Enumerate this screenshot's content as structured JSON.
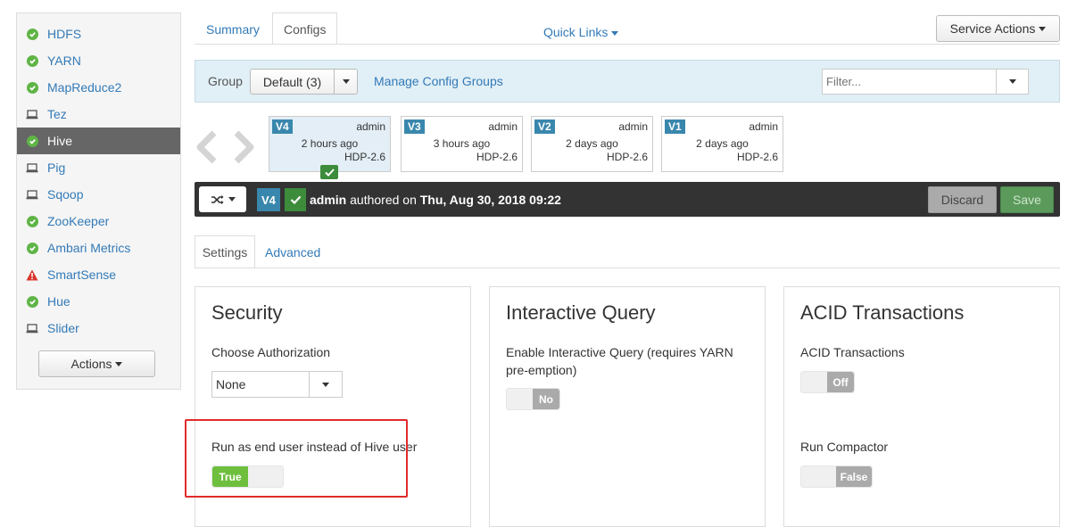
{
  "sidebar": {
    "items": [
      {
        "label": "HDFS",
        "status": "ok"
      },
      {
        "label": "YARN",
        "status": "ok"
      },
      {
        "label": "MapReduce2",
        "status": "ok"
      },
      {
        "label": "Tez",
        "status": "client"
      },
      {
        "label": "Hive",
        "status": "ok"
      },
      {
        "label": "Pig",
        "status": "client"
      },
      {
        "label": "Sqoop",
        "status": "client"
      },
      {
        "label": "ZooKeeper",
        "status": "ok"
      },
      {
        "label": "Ambari Metrics",
        "status": "ok"
      },
      {
        "label": "SmartSense",
        "status": "alert"
      },
      {
        "label": "Hue",
        "status": "ok"
      },
      {
        "label": "Slider",
        "status": "client"
      }
    ],
    "actions_label": "Actions"
  },
  "tabs": {
    "summary": "Summary",
    "configs": "Configs",
    "quick_links": "Quick Links",
    "service_actions": "Service Actions"
  },
  "group": {
    "label": "Group",
    "selected": "Default (3)",
    "manage": "Manage Config Groups",
    "filter_placeholder": "Filter..."
  },
  "versions": [
    {
      "tag": "V4",
      "user": "admin",
      "time": "2 hours ago",
      "stack": "HDP-2.6"
    },
    {
      "tag": "V3",
      "user": "admin",
      "time": "3 hours ago",
      "stack": "HDP-2.6"
    },
    {
      "tag": "V2",
      "user": "admin",
      "time": "2 days ago",
      "stack": "HDP-2.6"
    },
    {
      "tag": "V1",
      "user": "admin",
      "time": "2 days ago",
      "stack": "HDP-2.6"
    }
  ],
  "current": {
    "tag": "V4",
    "user": "admin",
    "authored": "authored on",
    "date": "Thu, Aug 30, 2018 09:22",
    "discard": "Discard",
    "save": "Save"
  },
  "settings_tabs": {
    "settings": "Settings",
    "advanced": "Advanced"
  },
  "panels": {
    "security": {
      "title": "Security",
      "auth_label": "Choose Authorization",
      "auth_value": "None",
      "run_as_label": "Run as end user instead of Hive user",
      "run_as_value": "True"
    },
    "interactive": {
      "title": "Interactive Query",
      "enable_label": "Enable Interactive Query (requires YARN pre-emption)",
      "enable_value": "No"
    },
    "acid": {
      "title": "ACID Transactions",
      "acid_label": "ACID Transactions",
      "acid_value": "Off",
      "compactor_label": "Run Compactor",
      "compactor_value": "False"
    }
  },
  "colors": {
    "ok": "#5fb446",
    "alert": "#d9342b",
    "link": "#337ab7",
    "version_tag": "#3a87ad",
    "highlight": "#e12b2b"
  }
}
